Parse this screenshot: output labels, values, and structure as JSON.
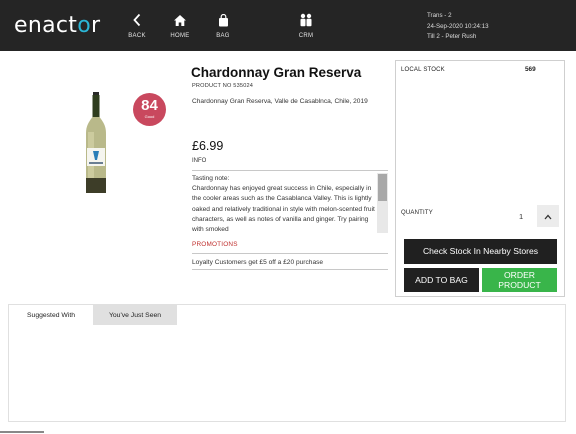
{
  "header": {
    "logo_text": "enactor",
    "nav": [
      {
        "label": "BACK",
        "icon": "chevron-left-icon"
      },
      {
        "label": "HOME",
        "icon": "home-icon"
      },
      {
        "label": "BAG",
        "icon": "bag-icon"
      },
      {
        "label": "CRM",
        "icon": "people-icon"
      }
    ],
    "transaction": {
      "trans": "Trans - 2",
      "datetime": "24-Sep-2020 10:24:13",
      "till": "Till 2 - Peter Rush"
    }
  },
  "product": {
    "score": "84",
    "score_sub": "Good",
    "name": "Chardonnay Gran Reserva",
    "product_no": "PRODUCT NO 535024",
    "origin": "Chardonnay Gran Reserva, Valle de Casablnca, Chile, 2019",
    "price": "£6.99",
    "info_label": "INFO",
    "tasting_note": "Tasting note:\nChardonnay has enjoyed great success in Chile, especially in the cooler areas such as the Casablanca Valley. This is lightly oaked and relatively traditional in style with melon-scented fruit characters, as well as notes of vanilla and ginger. Try pairing with smoked",
    "promotions_label": "PROMOTIONS",
    "promotion_text": "Loyalty Customers get £5 off a £20 purchase"
  },
  "stock_panel": {
    "local_stock_label": "LOCAL STOCK",
    "local_stock_value": "569",
    "quantity_label": "QUANTITY",
    "quantity_value": "1",
    "check_stock_label": "Check Stock In Nearby Stores",
    "add_to_bag_label": "ADD TO BAG",
    "order_product_label": "ORDER PRODUCT"
  },
  "tabs": [
    {
      "label": "Suggested With",
      "active": true
    },
    {
      "label": "You've Just Seen",
      "active": false
    }
  ],
  "colors": {
    "header_bg": "#252525",
    "logo_accent": "#2bb6d6",
    "score_badge": "#c9485e",
    "promotions": "#c0302e",
    "order_button": "#39b54a",
    "dark_button": "#202020"
  }
}
